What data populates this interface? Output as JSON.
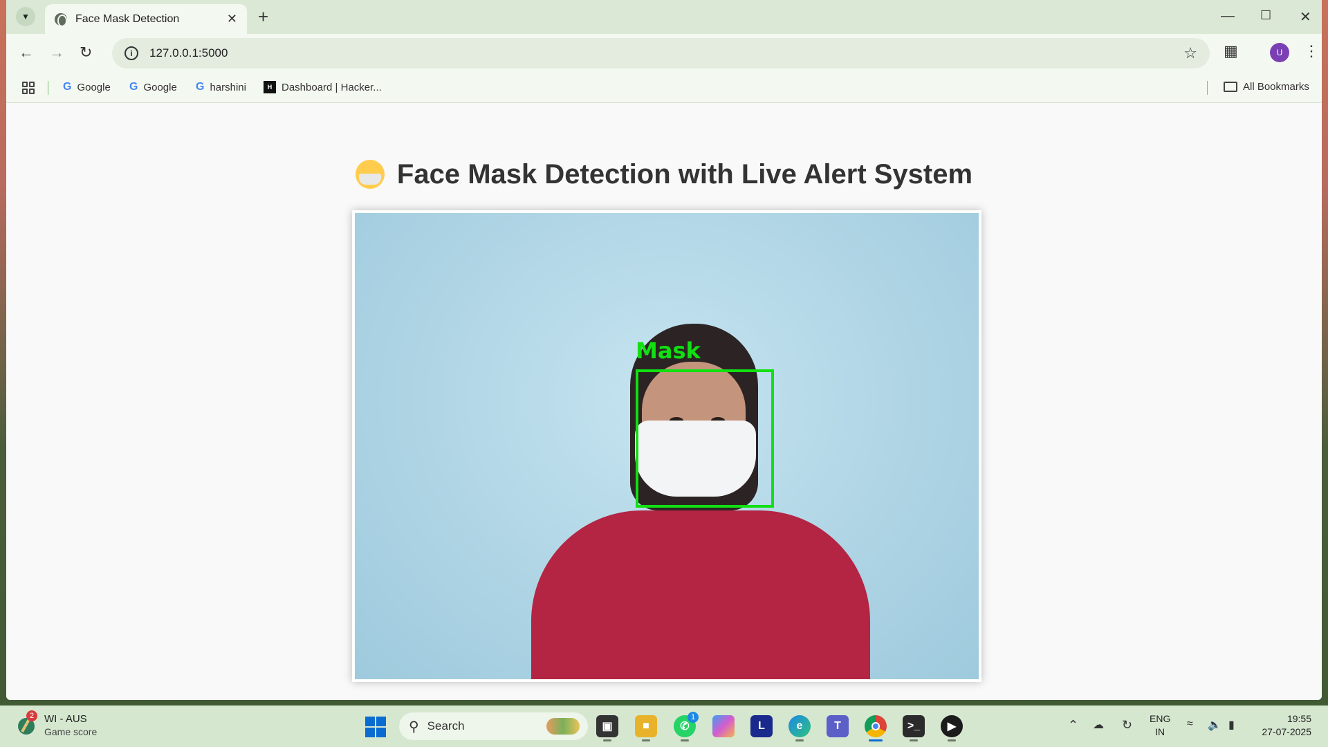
{
  "browser": {
    "tab_title": "Face Mask Detection",
    "url": "127.0.0.1:5000",
    "profile_initial": "U",
    "bookmarks": [
      {
        "label": "Google",
        "icon": "google-icon"
      },
      {
        "label": "Google",
        "icon": "google-icon"
      },
      {
        "label": "harshini",
        "icon": "google-icon"
      },
      {
        "label": "Dashboard | Hacker...",
        "icon": "hackerrank-icon"
      }
    ],
    "all_bookmarks_label": "All Bookmarks"
  },
  "page": {
    "title": "Face Mask Detection with Live Alert System",
    "title_emoji": "face-with-medical-mask",
    "detection_label": "Mask",
    "detection_color": "#11e011"
  },
  "taskbar": {
    "widget_title": "WI - AUS",
    "widget_subtitle": "Game score",
    "widget_badge": "2",
    "search_placeholder": "Search",
    "whatsapp_badge": "1",
    "language_line1": "ENG",
    "language_line2": "IN",
    "time": "19:55",
    "date": "27-07-2025"
  }
}
